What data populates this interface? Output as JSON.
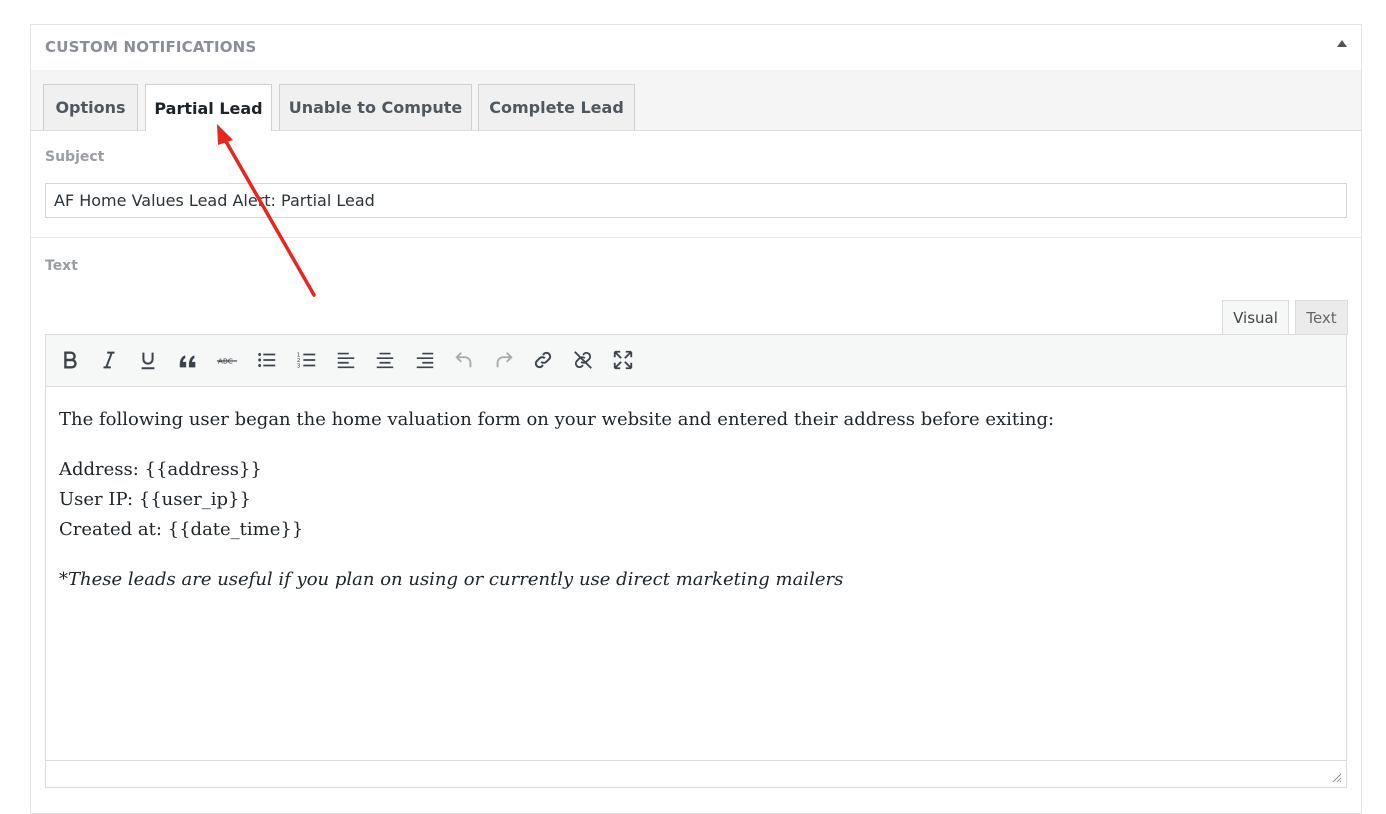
{
  "panel": {
    "title": "CUSTOM NOTIFICATIONS"
  },
  "tabs": [
    {
      "label": "Options",
      "active": false
    },
    {
      "label": "Partial Lead",
      "active": true
    },
    {
      "label": "Unable to Compute",
      "active": false
    },
    {
      "label": "Complete Lead",
      "active": false
    }
  ],
  "subject": {
    "label": "Subject",
    "value": "AF Home Values Lead Alert: Partial Lead"
  },
  "text_field": {
    "label": "Text"
  },
  "editor": {
    "mode_tabs": {
      "visual": "Visual",
      "text": "Text"
    },
    "active_mode": "Visual",
    "toolbar": [
      "bold-icon",
      "italic-icon",
      "underline-icon",
      "blockquote-icon",
      "strikethrough-icon",
      "bulleted-list-icon",
      "numbered-list-icon",
      "align-left-icon",
      "align-center-icon",
      "align-right-icon",
      "undo-icon",
      "redo-icon",
      "link-icon",
      "unlink-icon",
      "fullscreen-icon"
    ],
    "content": {
      "intro": "The following user began the home valuation form on your website and entered their address before exiting:",
      "address": "Address: {{address}}",
      "user_ip": "User IP: {{user_ip}}",
      "created_at": "Created at: {{date_time}}",
      "note": "*These leads are useful if you plan on using or currently use direct marketing mailers"
    }
  },
  "annotation": {
    "color": "#e8251e",
    "target": "Partial Lead"
  }
}
